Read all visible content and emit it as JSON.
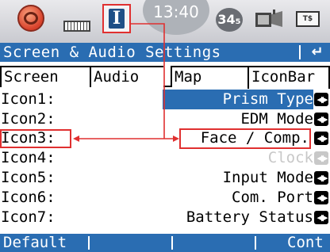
{
  "status": {
    "clock": "13:40",
    "satellites": "34₅",
    "battery_label": "T$",
    "icons": [
      "globe-icon",
      "keyboard-icon",
      "info-i-icon",
      "satellite-icon",
      "prism-icon",
      "battery-icon"
    ]
  },
  "title": {
    "text": "Screen & Audio Settings",
    "back_icon": "↵"
  },
  "tabs": [
    "Screen",
    "Audio",
    "Map",
    "IconBar"
  ],
  "active_tab": "IconBar",
  "rows": [
    {
      "label": "Icon1:",
      "value": "Prism Type"
    },
    {
      "label": "Icon2:",
      "value": "EDM Mode"
    },
    {
      "label": "Icon3:",
      "value": "Face / Comp."
    },
    {
      "label": "Icon4:",
      "value": "Clock"
    },
    {
      "label": "Icon5:",
      "value": "Input Mode"
    },
    {
      "label": "Icon6:",
      "value": "Com. Port"
    },
    {
      "label": "Icon7:",
      "value": "Battery Status"
    }
  ],
  "softkeys": [
    "Default",
    "",
    "",
    "Cont"
  ],
  "colors": {
    "accent": "#2a6db2",
    "annotation": "#e03030"
  }
}
